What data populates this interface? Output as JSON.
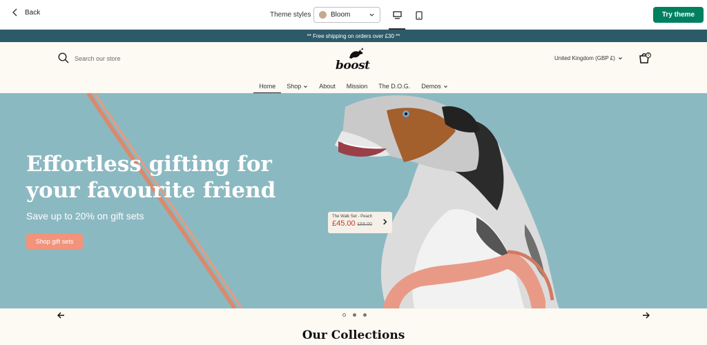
{
  "topbar": {
    "back_label": "Back",
    "theme_styles_label": "Theme styles",
    "theme_style_value": "Bloom",
    "theme_swatch_color": "#c7a98d",
    "try_theme_label": "Try theme",
    "accent_color": "#008060"
  },
  "announcement": {
    "text": "** Free shipping on orders over £30 **"
  },
  "header": {
    "search_placeholder": "Search our store",
    "logo_text": "boost",
    "currency": "United Kingdom (GBP £)",
    "cart_count": "0",
    "nav": [
      "Home",
      "Shop",
      "About",
      "Mission",
      "The D.O.G.",
      "Demos"
    ]
  },
  "hero": {
    "title": "Effortless gifting for your favourite friend",
    "subtitle": "Save up to 20% on gift sets",
    "cta_label": "Shop gift sets",
    "hotspot": {
      "name": "The Walk Set - Peach",
      "price": "£45.00",
      "old_price": "£56.00"
    }
  },
  "collections": {
    "title": "Our Collections"
  }
}
